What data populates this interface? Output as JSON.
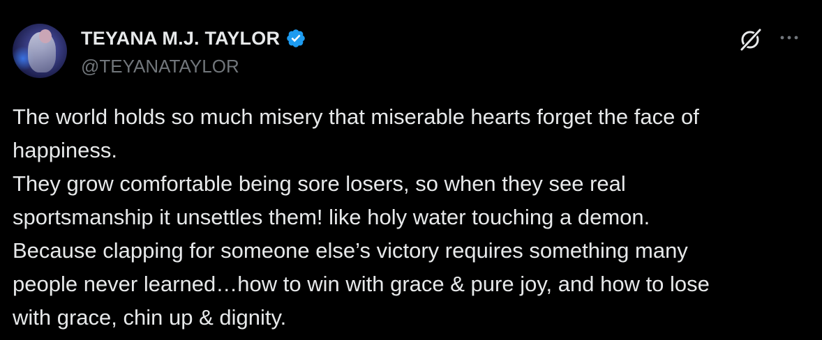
{
  "author": {
    "display_name": "TEYANA M.J. TAYLOR",
    "handle": "@TEYANATAYLOR",
    "verified": true,
    "verified_color": "#1d9bf0",
    "avatar_icon": "profile-photo"
  },
  "actions": {
    "grok_icon": "grok-icon",
    "more_icon": "more-icon"
  },
  "tweet": {
    "lines": [
      "The world holds so much misery that miserable hearts forget the face of",
      "happiness.",
      "They grow comfortable being sore losers, so when they see real",
      "sportsmanship it unsettles them! like holy water touching a demon.",
      "Because clapping for someone else’s victory requires something many",
      "people never learned…how to win with grace & pure joy, and how to lose",
      "with grace, chin up & dignity."
    ]
  },
  "colors": {
    "background": "#000000",
    "text": "#e7e9ea",
    "secondary_text": "#71767b",
    "accent": "#1d9bf0"
  }
}
